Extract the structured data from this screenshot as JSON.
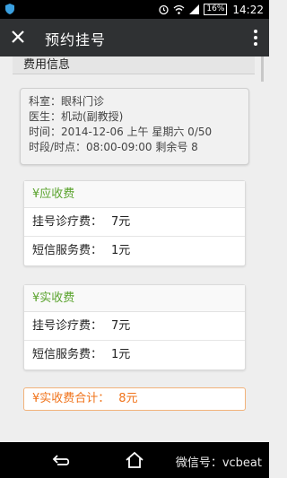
{
  "status_bar": {
    "battery": "16%",
    "time": "14:22"
  },
  "app_bar": {
    "title": "预约挂号"
  },
  "section": {
    "title": "费用信息"
  },
  "appointment": {
    "department": "科室：眼科门诊",
    "doctor": "医生：机动(副教授)",
    "time": "时间：2014-12-06 上午 星期六 0/50",
    "slot": "时段/时点：08:00-09:00 剩余号 8"
  },
  "due_fee": {
    "title": "¥应收费",
    "items": [
      {
        "label": "挂号诊疗费：",
        "value": "7元"
      },
      {
        "label": "短信服务费：",
        "value": "1元"
      }
    ]
  },
  "actual_fee": {
    "title": "¥实收费",
    "items": [
      {
        "label": "挂号诊疗费：",
        "value": "7元"
      },
      {
        "label": "短信服务费：",
        "value": "1元"
      }
    ]
  },
  "total": {
    "label": "¥实收费合计：",
    "value": "8元"
  },
  "watermark": "微信号：vcbeat"
}
